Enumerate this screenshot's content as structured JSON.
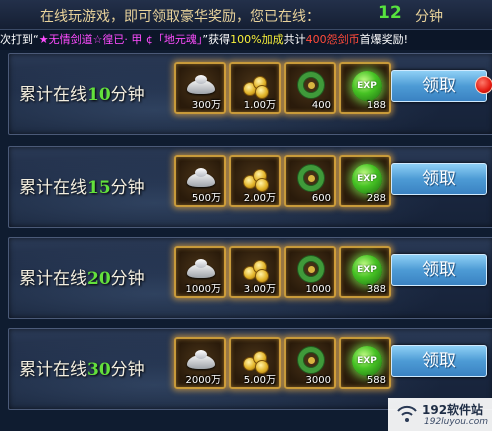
{
  "header": {
    "prompt": "在线玩游戏，即可领取豪华奖励，您已在线：",
    "online_minutes": "12",
    "unit": "分钟"
  },
  "ticker": {
    "prefix": "次打到“",
    "player": "★无情剑道☆徨已· 甲 ¢「地元魂」",
    "mid": "”获得",
    "bonus": "100%加成",
    "mid2": "共计",
    "reward": "400怨剑币",
    "suffix": "首爆奖励!"
  },
  "rewards": [
    {
      "label_prefix": "累计在线",
      "minutes": "10",
      "label_suffix": "分钟",
      "items": {
        "silver": "300万",
        "gold": "1.00万",
        "wreath": "400",
        "exp": "188"
      },
      "claim_label": "领取",
      "has_alert": true
    },
    {
      "label_prefix": "累计在线",
      "minutes": "15",
      "label_suffix": "分钟",
      "items": {
        "silver": "500万",
        "gold": "2.00万",
        "wreath": "600",
        "exp": "288"
      },
      "claim_label": "领取",
      "has_alert": false
    },
    {
      "label_prefix": "累计在线",
      "minutes": "20",
      "label_suffix": "分钟",
      "items": {
        "silver": "1000万",
        "gold": "3.00万",
        "wreath": "1000",
        "exp": "388"
      },
      "claim_label": "领取",
      "has_alert": false
    },
    {
      "label_prefix": "累计在线",
      "minutes": "30",
      "label_suffix": "分钟",
      "items": {
        "silver": "2000万",
        "gold": "5.00万",
        "wreath": "3000",
        "exp": "588"
      },
      "claim_label": "领取",
      "has_alert": false
    }
  ],
  "exp_badge": "EXP",
  "watermark": {
    "title": "192软件站",
    "url": "192luyou.com"
  },
  "icons": {
    "silver": "silver-ingot-icon",
    "gold": "gold-coins-icon",
    "wreath": "green-wreath-icon",
    "exp": "exp-orb-icon"
  },
  "colors": {
    "minutes_green": "#63e03c",
    "claim_blue": "#4d9bd5",
    "alert_red": "#e41a10",
    "slot_gold": "#c89a3a"
  }
}
